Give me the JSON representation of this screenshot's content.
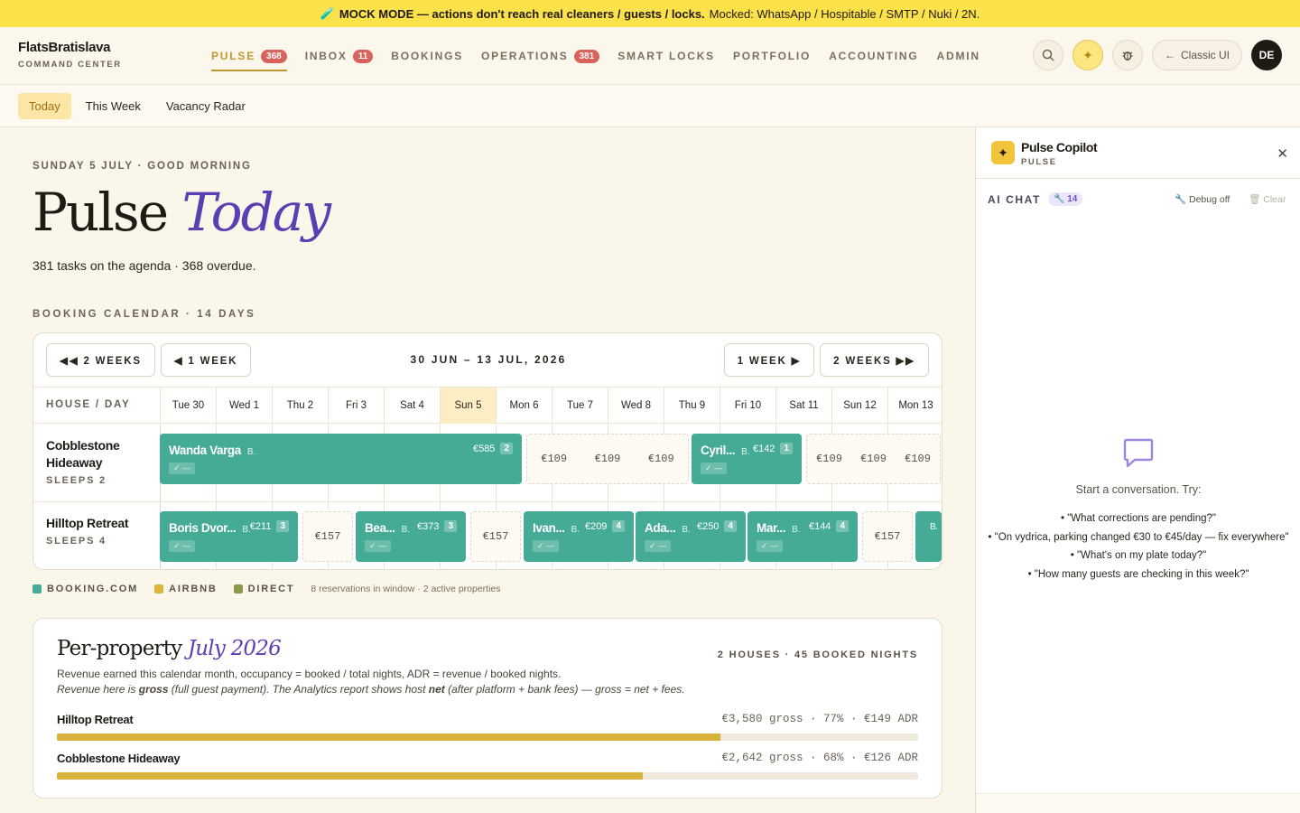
{
  "banner": {
    "icon": "🧪",
    "strong": "MOCK MODE — actions don't reach real cleaners / guests / locks.",
    "rest": "Mocked: WhatsApp / Hospitable / SMTP / Nuki / 2N."
  },
  "brand": {
    "name": "FlatsBratislava",
    "subtitle": "COMMAND CENTER"
  },
  "nav": [
    {
      "label": "PULSE",
      "badge": "368"
    },
    {
      "label": "INBOX",
      "badge": "11"
    },
    {
      "label": "BOOKINGS",
      "badge": null
    },
    {
      "label": "OPERATIONS",
      "badge": "381"
    },
    {
      "label": "SMART LOCKS",
      "badge": null
    },
    {
      "label": "PORTFOLIO",
      "badge": null
    },
    {
      "label": "ACCOUNTING",
      "badge": null
    },
    {
      "label": "ADMIN",
      "badge": null
    }
  ],
  "toolbar": {
    "classic_label": "Classic UI",
    "avatar_initials": "DE"
  },
  "subtabs": [
    "Today",
    "This Week",
    "Vacancy Radar"
  ],
  "page": {
    "date_line": "SUNDAY 5 JULY · GOOD MORNING",
    "title_plain": "Pulse",
    "title_accent": "Today",
    "summary": "381 tasks on the agenda · 368 overdue.",
    "calendar_label": "BOOKING CALENDAR · 14 DAYS"
  },
  "calendar": {
    "btn_back2": "◀◀ 2 WEEKS",
    "btn_back1": "◀ 1 WEEK",
    "btn_fwd1": "1 WEEK ▶",
    "btn_fwd2": "2 WEEKS ▶▶",
    "range": "30 JUN – 13 JUL, 2026",
    "house_header": "HOUSE / DAY",
    "days": [
      "Tue 30",
      "Wed 1",
      "Thu 2",
      "Fri 3",
      "Sat 4",
      "Sun 5",
      "Mon 6",
      "Tue 7",
      "Wed 8",
      "Thu 9",
      "Fri 10",
      "Sat 11",
      "Sun 12",
      "Mon 13"
    ],
    "today": "Sun 5",
    "rows": [
      {
        "name": "Cobblestone Hideaway",
        "sleeps": "SLEEPS 2",
        "booking_start_label": "B.",
        "status_chip": "✓ —",
        "bookings": [
          {
            "guest": "Wanda Varga",
            "source": "B.",
            "price": "€585",
            "nights": "2",
            "status": "✓ —",
            "start": 0,
            "span": 6.5
          },
          {
            "guest": "Cyril...",
            "source": "B.",
            "price": "€142",
            "nights": "1",
            "status": "✓ —",
            "start": 9.5,
            "span": 2
          }
        ],
        "free": [
          {
            "start": 6.5,
            "span": 3,
            "prices": [
              "€109",
              "€109",
              "€109"
            ]
          },
          {
            "start": 11.5,
            "span": 2.5,
            "prices": [
              "€109",
              "€109",
              "€109"
            ]
          }
        ]
      },
      {
        "name": "Hilltop Retreat",
        "sleeps": "SLEEPS 4",
        "bookings": [
          {
            "guest": "Boris Dvor...",
            "source": "B.",
            "price": "€211",
            "nights": "3",
            "status": "✓ —",
            "start": 0,
            "span": 2.5
          },
          {
            "guest": "Bea...",
            "source": "B.",
            "price": "€373",
            "nights": "3",
            "status": "✓ —",
            "start": 3.5,
            "span": 2
          },
          {
            "guest": "Ivan...",
            "source": "B.",
            "price": "€209",
            "nights": "4",
            "status": "✓ —",
            "start": 6.5,
            "span": 2
          },
          {
            "guest": "Ada...",
            "source": "B.",
            "price": "€250",
            "nights": "4",
            "status": "✓ —",
            "start": 8.5,
            "span": 2
          },
          {
            "guest": "Mar...",
            "source": "B.",
            "price": "€144",
            "nights": "4",
            "status": "✓ —",
            "start": 10.5,
            "span": 2
          },
          {
            "guest": "",
            "source": "B.",
            "price": "",
            "nights": "",
            "status": "",
            "start": 13.5,
            "span": 0.5
          }
        ],
        "free": [
          {
            "start": 2.5,
            "span": 1,
            "prices": [
              "€157"
            ]
          },
          {
            "start": 5.5,
            "span": 1,
            "prices": [
              "€157"
            ]
          },
          {
            "start": 12.5,
            "span": 1,
            "prices": [
              "€157"
            ]
          }
        ]
      }
    ]
  },
  "legend": {
    "items": [
      {
        "label": "BOOKING.COM",
        "color": "#45ab97"
      },
      {
        "label": "AIRBNB",
        "color": "#e0b43a"
      },
      {
        "label": "DIRECT",
        "color": "#8a9a4a"
      }
    ],
    "note": "8 reservations in window · 2 active properties"
  },
  "per_property": {
    "title_plain": "Per-property",
    "title_accent": "July 2026",
    "meta": "2 HOUSES · 45 BOOKED NIGHTS",
    "desc1": "Revenue earned this calendar month, occupancy = booked / total nights, ADR = revenue / booked nights.",
    "desc2_a": "Revenue here is ",
    "desc2_b": "gross",
    "desc2_c": " (full guest payment). The Analytics report shows host ",
    "desc2_d": "net",
    "desc2_e": " (after platform + bank fees) — gross = net + fees.",
    "properties": [
      {
        "name": "Hilltop Retreat",
        "stats": "€3,580 gross · 77% · €149 ADR",
        "occupancy": 0.77
      },
      {
        "name": "Cobblestone Hideaway",
        "stats": "€2,642 gross · 68% · €126 ADR",
        "occupancy": 0.68
      }
    ]
  },
  "copilot": {
    "title": "Pulse Copilot",
    "subtitle": "PULSE",
    "chat_label": "AI CHAT",
    "tools_count": "14",
    "debug": "Debug off",
    "clear": "Clear",
    "start": "Start a conversation. Try:",
    "suggestions": [
      "• \"What corrections are pending?\"",
      "• \"On vydrica, parking changed €30 to €45/day — fix everywhere\"",
      "• \"What's on my plate today?\"",
      "• \"How many guests are checking in this week?\""
    ]
  }
}
